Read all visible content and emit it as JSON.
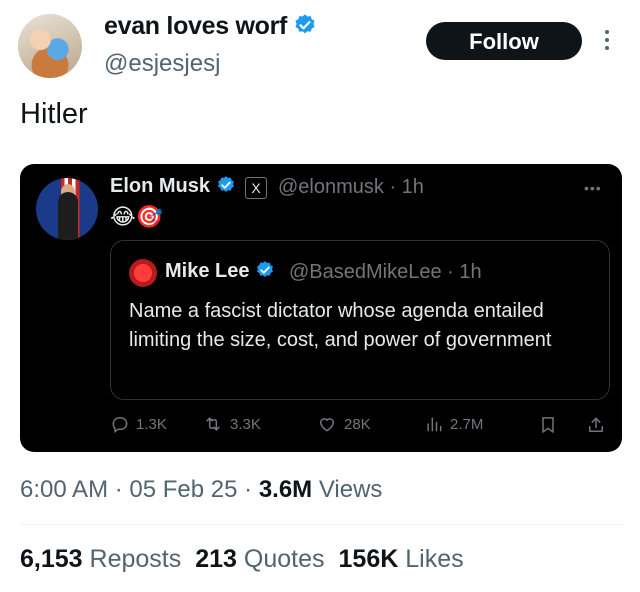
{
  "author": {
    "display_name": "evan loves worf",
    "handle": "@esjesjesj"
  },
  "follow_label": "Follow",
  "tweet_text": "Hitler",
  "embedded": {
    "name": "Elon Musk",
    "handle_time": "@elonmusk · 1h",
    "x_badge": "X",
    "emojis": "😂🎯",
    "quote": {
      "name": "Mike Lee",
      "handle_time": "@BasedMikeLee · 1h",
      "text": "Name a fascist dictator whose agenda entailed limiting the size, cost, and power of government"
    },
    "actions": {
      "replies": "1.3K",
      "reposts": "3.3K",
      "likes": "28K",
      "views": "2.7M"
    }
  },
  "meta": {
    "time": "6:00 AM",
    "date": "05 Feb 25",
    "views_count": "3.6M",
    "views_label": "Views"
  },
  "stats": {
    "reposts_count": "6,153",
    "reposts_label": "Reposts",
    "quotes_count": "213",
    "quotes_label": "Quotes",
    "likes_count": "156K",
    "likes_label": "Likes"
  },
  "colors": {
    "verified": "#1d9bf0",
    "text": "#0f1419",
    "secondary": "#536471"
  }
}
